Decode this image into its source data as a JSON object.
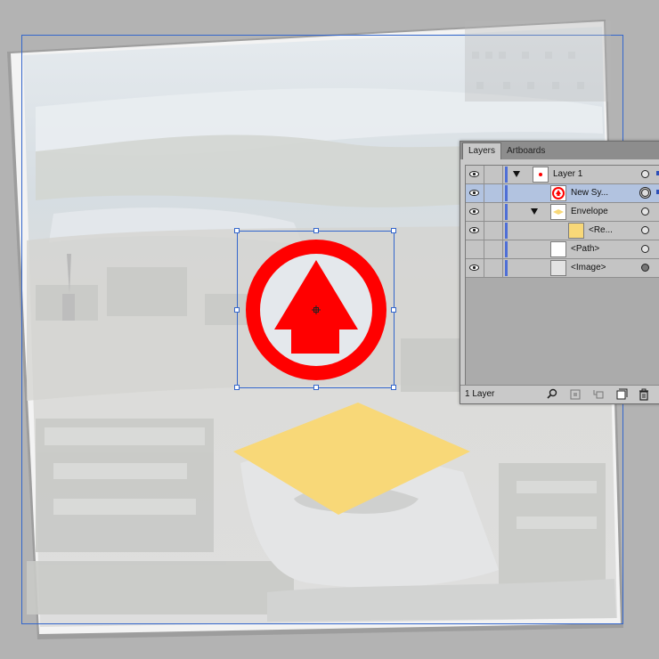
{
  "panel": {
    "tabs": [
      {
        "label": "Layers",
        "active": true
      },
      {
        "label": "Artboards",
        "active": false
      }
    ],
    "layers": [
      {
        "name": "Layer 1",
        "visible": true,
        "expanded": true,
        "selected": false,
        "target": "hollow",
        "thumb": "layer"
      },
      {
        "name": "New Sy...",
        "visible": true,
        "expanded": false,
        "selected": true,
        "target": "double",
        "thumb": "symbol"
      },
      {
        "name": "Envelope",
        "visible": true,
        "expanded": true,
        "selected": false,
        "target": "hollow",
        "thumb": "envelope"
      },
      {
        "name": "<Re...",
        "visible": true,
        "expanded": false,
        "selected": false,
        "target": "hollow",
        "thumb": "rect"
      },
      {
        "name": "<Path>",
        "visible": false,
        "expanded": false,
        "selected": false,
        "target": "hollow",
        "thumb": "blank"
      },
      {
        "name": "<Image>",
        "visible": true,
        "expanded": false,
        "selected": false,
        "target": "filled",
        "thumb": "image"
      }
    ],
    "footer": {
      "layer_count": "1 Layer"
    }
  },
  "canvas": {
    "symbol_color": "#ff0000",
    "envelope_color": "#f8d878",
    "selection_color": "#3366cc",
    "artboard_border": "#3366cc"
  }
}
